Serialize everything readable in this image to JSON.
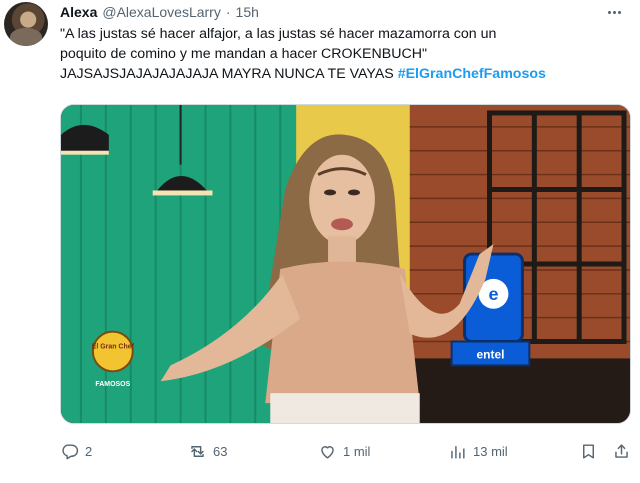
{
  "tweet": {
    "author_name": "Alexa",
    "author_handle": "@AlexaLovesLarry",
    "separator": "·",
    "time": "15h",
    "text_lines": [
      "\"A las justas sé hacer alfajor, a las justas sé hacer mazamorra con un",
      "poquito de comino y me mandan a hacer CROKENBUCH\"",
      "JAJSAJSJAJAJAJAJAJA MAYRA NUNCA TE VAYAS "
    ],
    "hashtag": "#ElGranChefFamosos"
  },
  "media": {
    "overlay_phone_text": "entel",
    "logo_text": "El Gran Chef",
    "logo_subtext": "FAMOSOS"
  },
  "actions": {
    "replies": "2",
    "retweets": "63",
    "likes": "1 mil",
    "views": "13 mil"
  },
  "icons": {
    "reply": "reply-icon",
    "retweet": "retweet-icon",
    "like": "heart-icon",
    "views": "views-icon",
    "bookmark": "bookmark-icon",
    "share": "share-icon",
    "more": "more-icon"
  },
  "colors": {
    "hashtag": "#1d9bf0",
    "muted": "#536471",
    "text": "#0f1419",
    "entel_blue": "#0a5dd6"
  }
}
